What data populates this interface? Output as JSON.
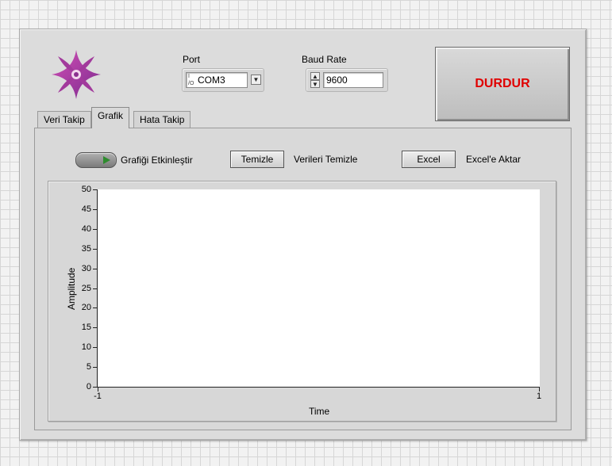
{
  "port": {
    "label": "Port",
    "value": "COM3",
    "io_glyph": "I/O"
  },
  "baud": {
    "label": "Baud Rate",
    "value": "9600"
  },
  "stop_button": {
    "label": "DURDUR",
    "color": "#e00000"
  },
  "tabs": [
    {
      "label": "Veri Takip",
      "active": false
    },
    {
      "label": "Grafik",
      "active": true
    },
    {
      "label": "Hata Takip",
      "active": false
    }
  ],
  "graph_panel": {
    "enable_label": "Grafiği Etkinleştir",
    "enable_on": true,
    "clear_button": "Temizle",
    "clear_caption": "Verileri Temizle",
    "excel_button": "Excel",
    "excel_caption": "Excel'e Aktar"
  },
  "chart_data": {
    "type": "line",
    "xlabel": "Time",
    "ylabel": "Amplitude",
    "xlim": [
      -1,
      1
    ],
    "ylim": [
      0,
      50
    ],
    "x_ticks": [
      "-1",
      "1"
    ],
    "y_ticks": [
      "0",
      "5",
      "10",
      "15",
      "20",
      "25",
      "30",
      "35",
      "40",
      "45",
      "50"
    ],
    "series": []
  },
  "logo_icon": "four-point-star-logo-icon"
}
